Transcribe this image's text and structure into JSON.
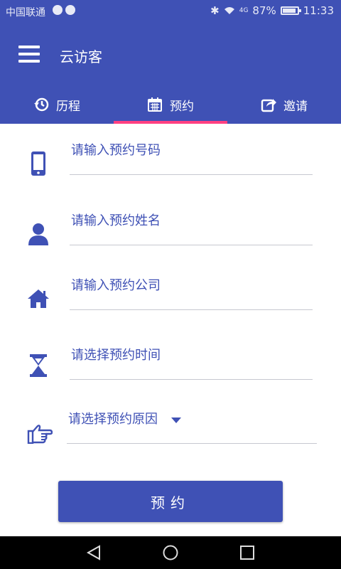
{
  "status_bar": {
    "carrier": "中国联通",
    "signal": "4G",
    "battery": "87%",
    "time": "11:33"
  },
  "app_bar": {
    "title": "云访客"
  },
  "tabs": [
    {
      "label": "历程",
      "icon": "history-icon"
    },
    {
      "label": "预约",
      "icon": "calendar-icon",
      "active": true
    },
    {
      "label": "邀请",
      "icon": "share-icon"
    }
  ],
  "form": {
    "phone_placeholder": "请输入预约号码",
    "name_placeholder": "请输入预约姓名",
    "company_placeholder": "请输入预约公司",
    "time_placeholder": "请选择预约时间",
    "reason_placeholder": "请选择预约原因"
  },
  "submit_label": "预约",
  "colors": {
    "primary": "#3f51b5",
    "accent": "#ff4081"
  }
}
